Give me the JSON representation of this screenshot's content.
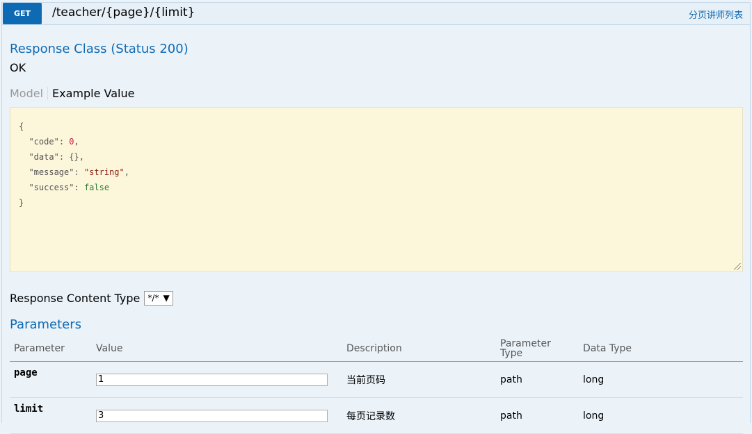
{
  "operation": {
    "method": "GET",
    "path": "/teacher/{page}/{limit}",
    "summary": "分页讲师列表"
  },
  "response": {
    "class_title": "Response Class (Status 200)",
    "status_text": "OK",
    "tabs": {
      "model": "Model",
      "example": "Example Value"
    },
    "example": {
      "open": "{",
      "close": "}",
      "lines": [
        {
          "key": "\"code\"",
          "sep": ": ",
          "value": "0",
          "trail": ","
        },
        {
          "key": "\"data\"",
          "sep": ": ",
          "value": "{}",
          "trail": ","
        },
        {
          "key": "\"message\"",
          "sep": ": ",
          "value": "\"string\"",
          "trail": ","
        },
        {
          "key": "\"success\"",
          "sep": ": ",
          "value": "false",
          "trail": ""
        }
      ]
    },
    "content_type_label": "Response Content Type",
    "content_type_value": "*/*"
  },
  "parameters": {
    "title": "Parameters",
    "headers": {
      "parameter": "Parameter",
      "value": "Value",
      "description": "Description",
      "parameter_type_1": "Parameter",
      "parameter_type_2": "Type",
      "data_type": "Data Type"
    },
    "rows": [
      {
        "name": "page",
        "value": "1",
        "description": "当前页码",
        "param_type": "path",
        "data_type": "long"
      },
      {
        "name": "limit",
        "value": "3",
        "description": "每页记录数",
        "param_type": "path",
        "data_type": "long"
      }
    ]
  },
  "colors": {
    "method_bg": "#0f6ab4",
    "panel_bg": "#ebf3f9",
    "snippet_bg": "#fcf6db"
  },
  "icons": {
    "dropdown": "triangle-down-icon",
    "resize": "resize-handle-icon"
  }
}
